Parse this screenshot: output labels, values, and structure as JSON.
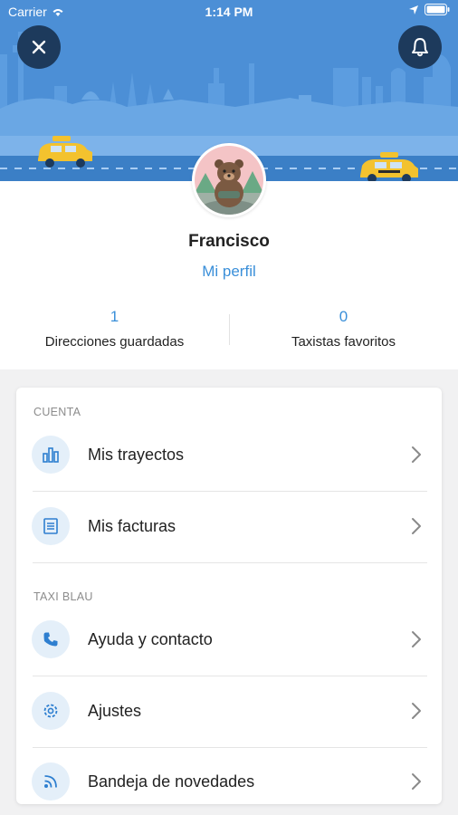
{
  "status_bar": {
    "carrier": "Carrier",
    "time": "1:14 PM"
  },
  "profile": {
    "name": "Francisco",
    "link": "Mi perfil",
    "stats": [
      {
        "value": "1",
        "label": "Direcciones guardadas"
      },
      {
        "value": "0",
        "label": "Taxistas favoritos"
      }
    ]
  },
  "menu": {
    "sections": [
      {
        "title": "CUENTA",
        "items": [
          {
            "label": "Mis trayectos",
            "icon": "bar-chart-icon"
          },
          {
            "label": "Mis facturas",
            "icon": "receipt-icon"
          }
        ]
      },
      {
        "title": "TAXI BLAU",
        "items": [
          {
            "label": "Ayuda y contacto",
            "icon": "phone-icon"
          },
          {
            "label": "Ajustes",
            "icon": "gear-icon"
          },
          {
            "label": "Bandeja de novedades",
            "icon": "rss-icon"
          }
        ]
      }
    ]
  },
  "colors": {
    "header_blue": "#4c8fd6",
    "accent": "#3a8fd9",
    "taxi_yellow": "#f3c22e",
    "dark_button": "#1d3a5c",
    "icon_bg": "#e4eff9"
  }
}
